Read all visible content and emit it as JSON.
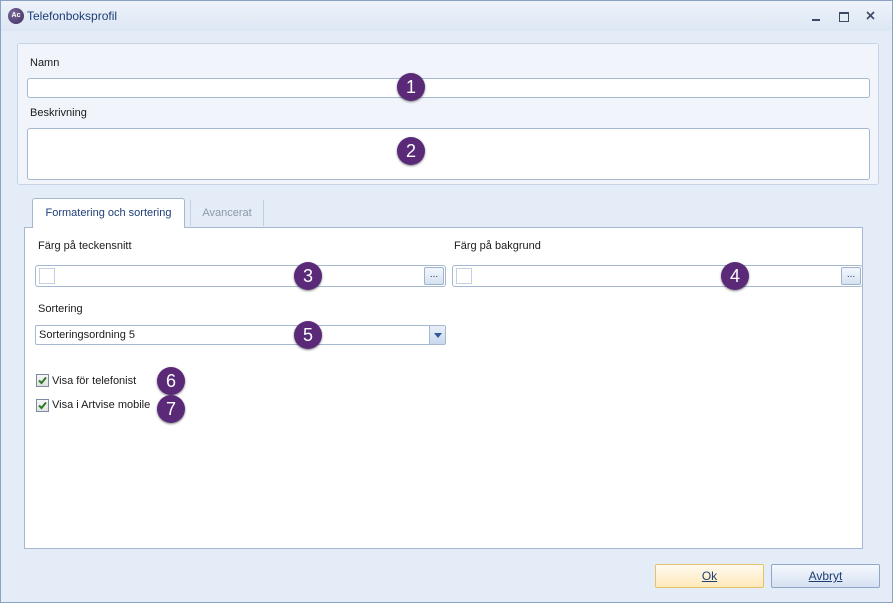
{
  "window": {
    "title": "Telefonboksprofil",
    "app_icon_text": "Ac",
    "controls": [
      "minimize",
      "maximize",
      "close"
    ]
  },
  "form": {
    "name_label": "Namn",
    "name_value": "",
    "description_label": "Beskrivning",
    "description_value": ""
  },
  "tabs": [
    {
      "label": "Formatering och sortering",
      "active": true
    },
    {
      "label": "Avancerat",
      "active": false
    }
  ],
  "formatting": {
    "font_color_label": "Färg på teckensnitt",
    "background_color_label": "Färg på bakgrund",
    "ellipsis_label": "...",
    "sorting_label": "Sortering",
    "sorting_value": "Sorteringsordning 5",
    "show_operator_label": "Visa för telefonist",
    "show_operator_checked": true,
    "show_mobile_label": "Visa i Artvise mobile",
    "show_mobile_checked": true
  },
  "badges": [
    "1",
    "2",
    "3",
    "4",
    "5",
    "6",
    "7"
  ],
  "buttons": {
    "ok_label": "Ok",
    "cancel_label": "Avbryt"
  },
  "colors": {
    "accent": "#1e3e75",
    "badge": "#5a2a78",
    "window_bg": "#e3ecf7",
    "check": "#2d7a24"
  },
  "icons": {
    "app": "app-logo-icon",
    "minimize": "minimize-icon",
    "maximize": "maximize-icon",
    "close": "close-icon",
    "dropdown": "chevron-down-icon",
    "check": "checkmark-icon"
  }
}
